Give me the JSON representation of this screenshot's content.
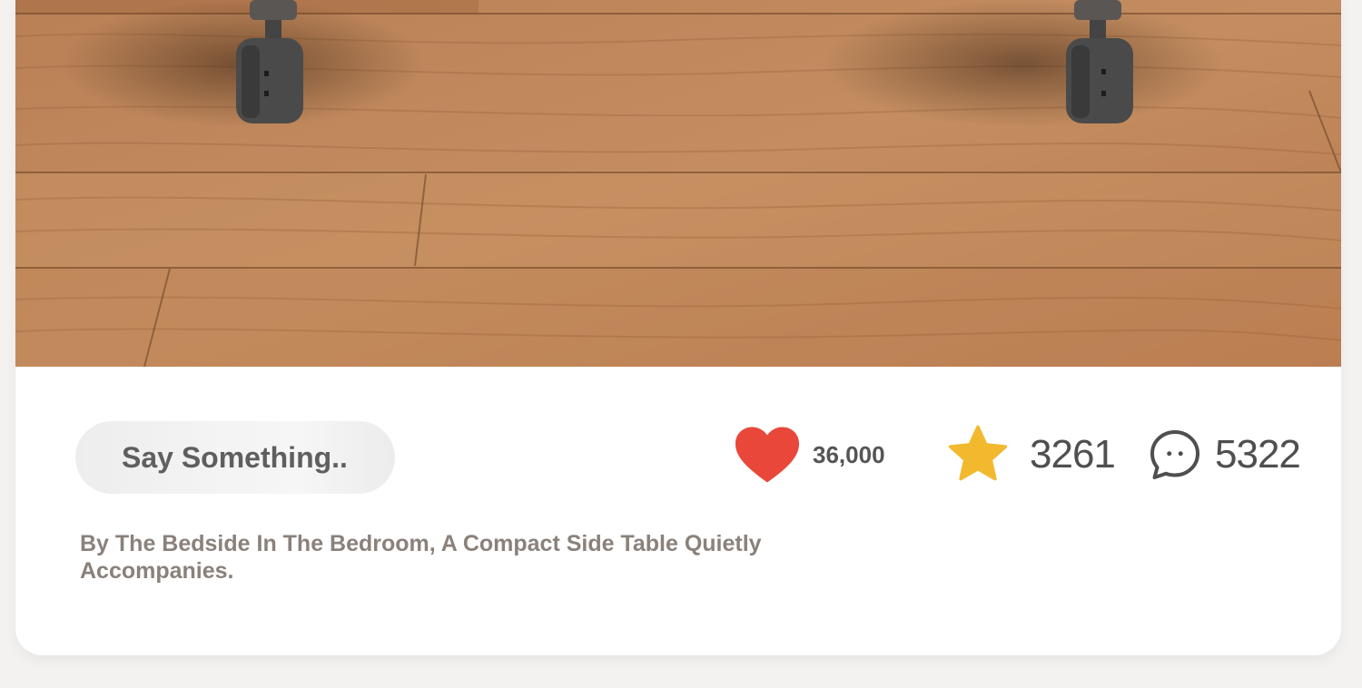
{
  "post": {
    "image_alt": "Wooden floor with caster wheels of a side table",
    "caption": "By The Bedside In The Bedroom, A Compact Side Table Quietly Accompanies."
  },
  "comment_box": {
    "placeholder": "Say Something.."
  },
  "stats": {
    "likes": "36,000",
    "favorites": "3261",
    "comments": "5322"
  },
  "icons": {
    "like": "heart-icon",
    "favorite": "star-icon",
    "comment": "chat-bubble-icon"
  },
  "colors": {
    "heart": "#e8473a",
    "star": "#f2b92f",
    "caption_text": "#8a817b"
  }
}
